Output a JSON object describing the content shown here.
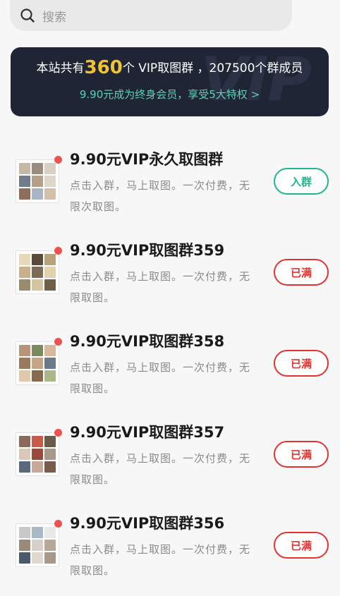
{
  "search": {
    "placeholder": "搜索",
    "icon": "search-icon"
  },
  "banner": {
    "prefix": "本站共有",
    "count": "360",
    "suffix": "个 VIP取图群 ，207500个群成员",
    "link": "9.90元成为终身会员，享受5大特权 >",
    "colors": {
      "background": "#1f2535",
      "highlight": "#f1c232",
      "link": "#5fd0b4"
    }
  },
  "groups": [
    {
      "title": "9.90元VIP永久取图群",
      "desc": "点击入群，马上取图。一次付费，无限次取图。",
      "action": "入群",
      "status": "join"
    },
    {
      "title": "9.90元VIP取图群359",
      "desc": "点击入群，马上取图。一次付费，无限取图。",
      "action": "已满",
      "status": "full"
    },
    {
      "title": "9.90元VIP取图群358",
      "desc": "点击入群，马上取图。一次付费，无限取图。",
      "action": "已满",
      "status": "full"
    },
    {
      "title": "9.90元VIP取图群357",
      "desc": "点击入群，马上取图。一次付费，无限取图。",
      "action": "已满",
      "status": "full"
    },
    {
      "title": "9.90元VIP取图群356",
      "desc": "点击入群，马上取图。一次付费，无限取图。",
      "action": "已满",
      "status": "full"
    }
  ],
  "colors": {
    "join": "#1fb58f",
    "full": "#e3322f",
    "badge_dot": "#f0504f"
  }
}
